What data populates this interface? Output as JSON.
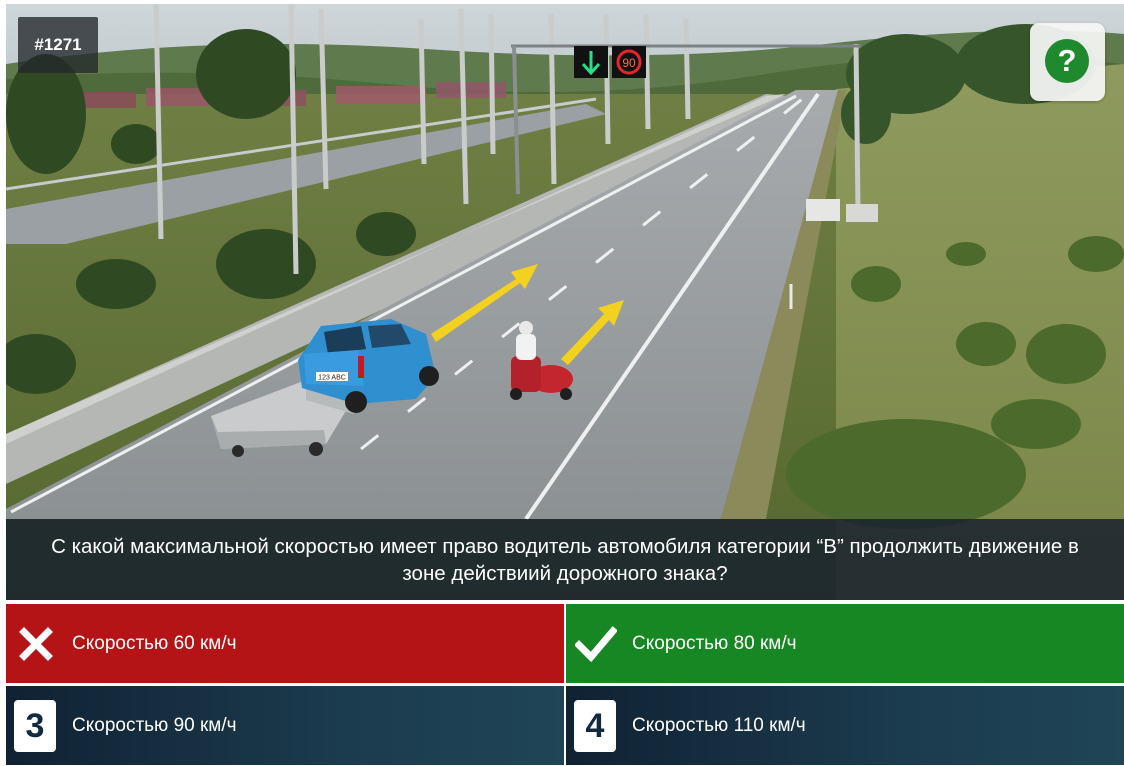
{
  "question": {
    "id_label": "#1271",
    "text": "С какой максимальной скоростью имеет право водитель автомобиля категории “B” продолжить движение в зоне действиий дорожного знака?"
  },
  "scene": {
    "sign_speed_limit": "90",
    "car_plate": "123 ABC",
    "colors": {
      "arrow": "#f3d21f",
      "car": "#2f8fcf",
      "sidecar": "#c4262e"
    }
  },
  "help_button": {
    "symbol": "?",
    "icon": "question-circle-icon"
  },
  "answers": [
    {
      "label": "Скоростью 60 км/ч",
      "state": "wrong",
      "icon": "cross-icon"
    },
    {
      "label": "Скоростью 80 км/ч",
      "state": "correct",
      "icon": "check-icon"
    },
    {
      "number": "3",
      "label": "Скоростью 90 км/ч",
      "state": "neutral"
    },
    {
      "number": "4",
      "label": "Скоростью 110 км/ч",
      "state": "neutral"
    }
  ],
  "colors": {
    "wrong": "#b41416",
    "correct": "#168723",
    "neutral": "#15303f",
    "help_green": "#1f8a2d"
  }
}
